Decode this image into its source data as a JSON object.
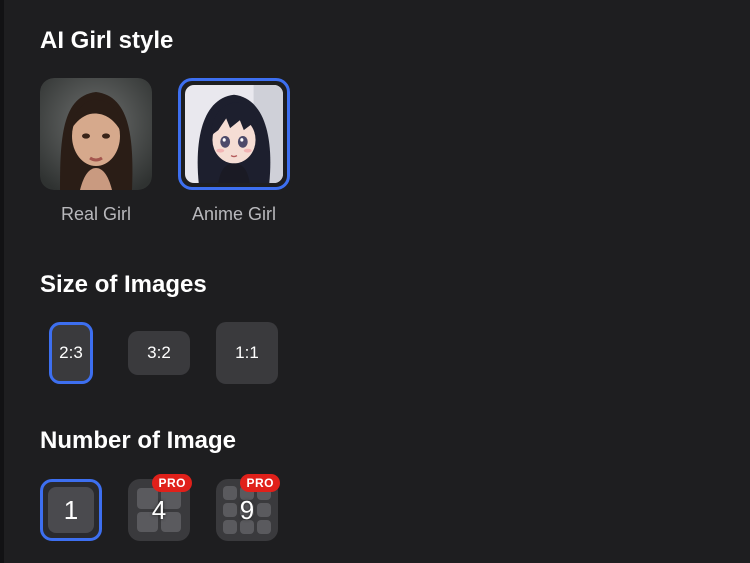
{
  "style_section": {
    "title": "AI Girl style",
    "options": [
      {
        "label": "Real Girl",
        "selected": false
      },
      {
        "label": "Anime Girl",
        "selected": true
      }
    ]
  },
  "size_section": {
    "title": "Size of Images",
    "options": [
      {
        "label": "2:3",
        "selected": true
      },
      {
        "label": "3:2",
        "selected": false
      },
      {
        "label": "1:1",
        "selected": false
      }
    ]
  },
  "number_section": {
    "title": "Number of Image",
    "options": [
      {
        "label": "1",
        "selected": true,
        "badge": ""
      },
      {
        "label": "4",
        "selected": false,
        "badge": "PRO"
      },
      {
        "label": "9",
        "selected": false,
        "badge": "PRO"
      }
    ]
  },
  "colors": {
    "background": "#1e1e20",
    "accent": "#3d6ff0",
    "button": "#3a3a3d",
    "pro_badge": "#e0201a"
  }
}
